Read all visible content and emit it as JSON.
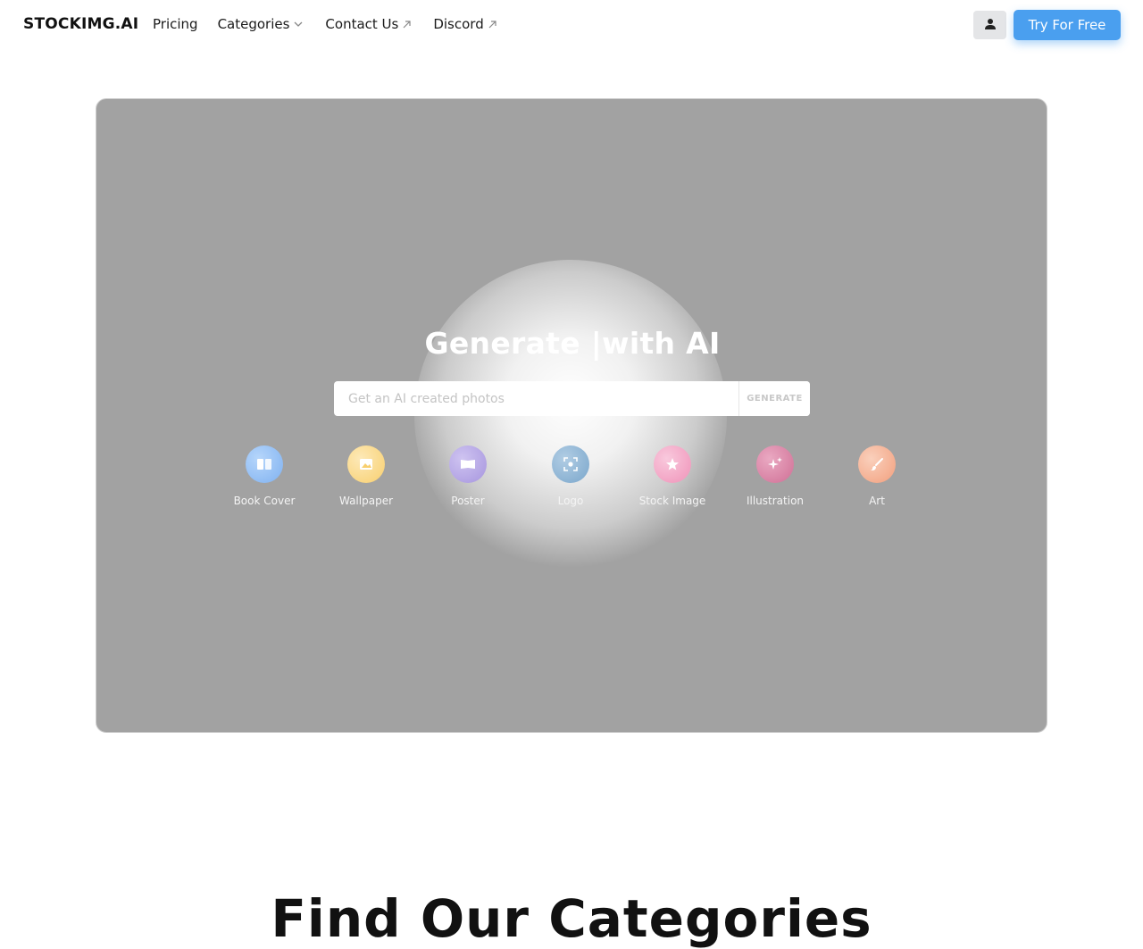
{
  "header": {
    "logo": "STOCKIMG.AI",
    "nav": {
      "pricing": "Pricing",
      "categories": "Categories",
      "contact": "Contact Us",
      "discord": "Discord"
    },
    "user_icon": "user-icon",
    "cta_label": "Try For Free",
    "cta_color": "#4a9fef"
  },
  "hero": {
    "title": "Generate |with AI",
    "search_placeholder": "Get an AI created photos",
    "generate_label": "GENERATE",
    "background_color": "#a2a2a2",
    "categories": [
      {
        "label": "Book Cover",
        "icon": "book-icon",
        "color": "#8fbef5"
      },
      {
        "label": "Wallpaper",
        "icon": "image-icon",
        "color": "#fbd98a"
      },
      {
        "label": "Poster",
        "icon": "poster-icon",
        "color": "#b7a8e6"
      },
      {
        "label": "Logo",
        "icon": "focus-icon",
        "color": "#8eb6d6"
      },
      {
        "label": "Stock Image",
        "icon": "star-icon",
        "color": "#f3a7c7"
      },
      {
        "label": "Illustration",
        "icon": "sparkles-icon",
        "color": "#dc87a8"
      },
      {
        "label": "Art",
        "icon": "brush-icon",
        "color": "#f5b79b"
      }
    ]
  },
  "section": {
    "title": "Find Our Categories"
  }
}
